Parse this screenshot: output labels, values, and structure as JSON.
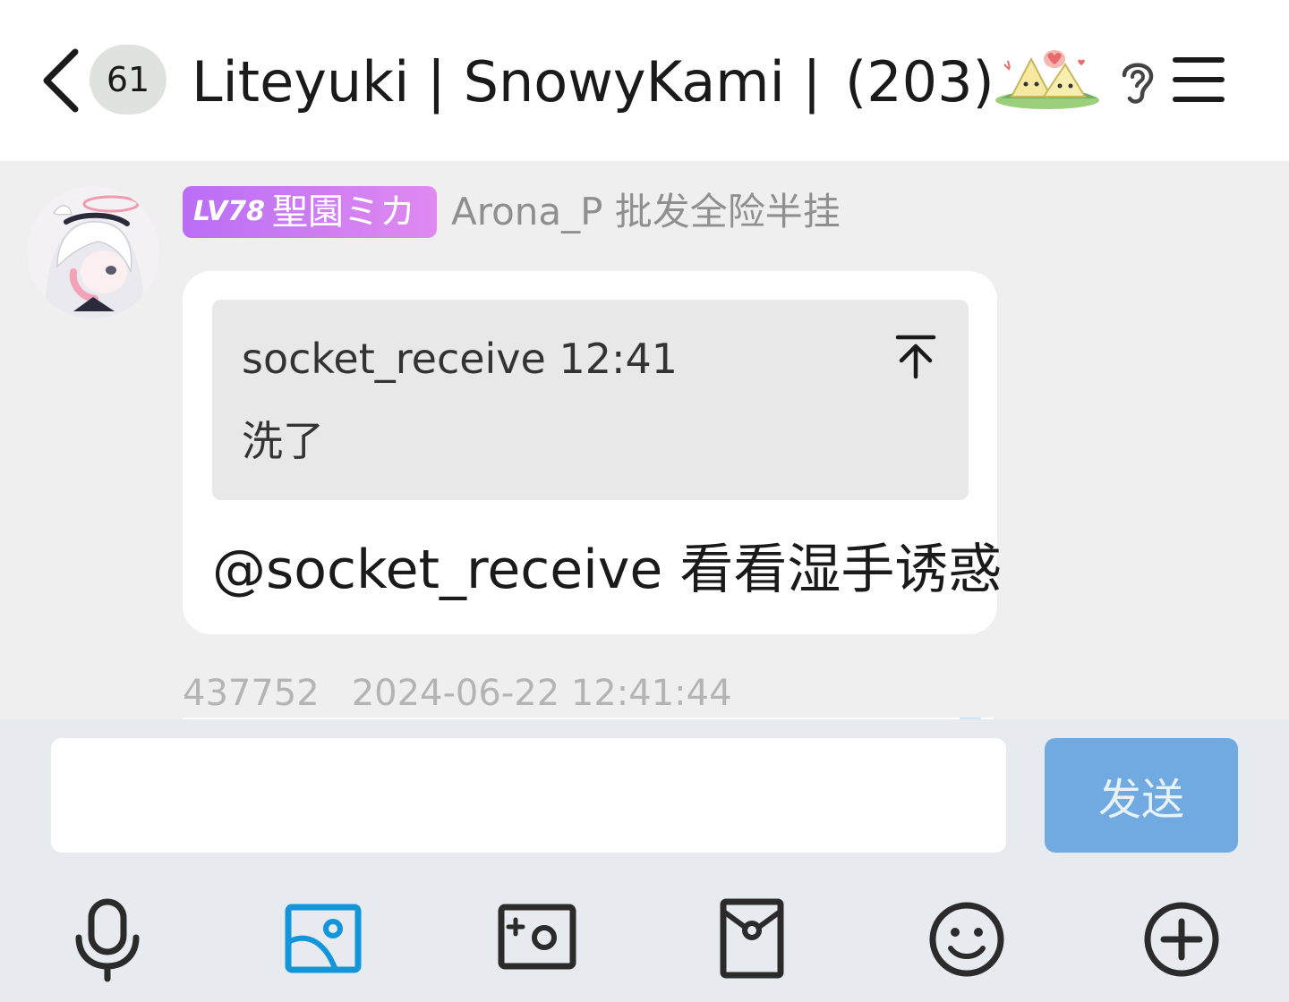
{
  "header": {
    "unread_count": "61",
    "title": "Liteyuki | SnowyKami |…",
    "member_count": "(203)"
  },
  "message": {
    "level": "LV78",
    "level_title": "聖園ミカ",
    "sender": "Arona_P 批发全险半挂",
    "quote": {
      "author": "socket_receive",
      "time": "12:41",
      "text": "洗了"
    },
    "text": "@socket_receive 看看湿手诱惑",
    "id": "437752",
    "timestamp": "2024-06-22 12:41:44"
  },
  "input": {
    "value": "",
    "send_label": "发送"
  },
  "colors": {
    "accent": "#1296db",
    "send_button": "#71aae0",
    "level_badge_start": "#b96ef5",
    "level_badge_end": "#e08af0",
    "meta_text": "#b4b4b4"
  },
  "toolbar": [
    {
      "icon": "microphone-icon"
    },
    {
      "icon": "image-icon",
      "active": true
    },
    {
      "icon": "camera-icon"
    },
    {
      "icon": "red-packet-icon"
    },
    {
      "icon": "emoji-icon"
    },
    {
      "icon": "plus-icon"
    }
  ]
}
